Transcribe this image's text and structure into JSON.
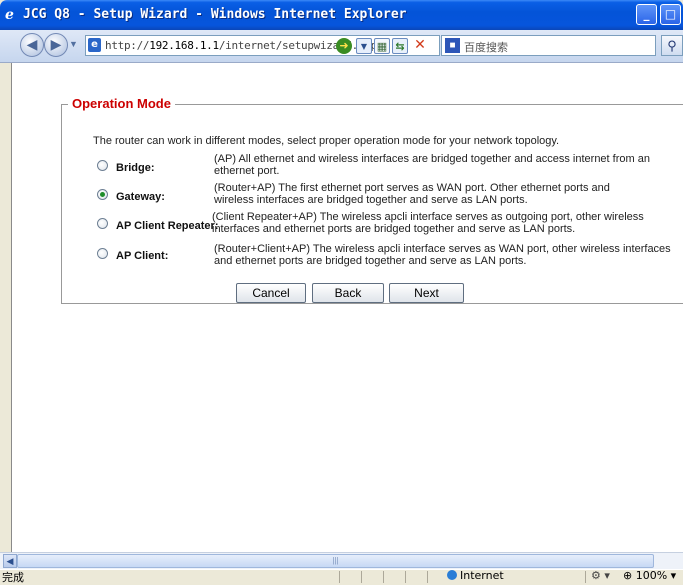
{
  "window": {
    "title": "JCG Q8 - Setup Wizard - Windows Internet Explorer",
    "icon": "ie-logo-icon"
  },
  "addressbar": {
    "url_prefix": "http://",
    "url_host": "192.168.1.1",
    "url_path": "/internet/setupwizard.asp",
    "search_placeholder": "百度搜索"
  },
  "page": {
    "legend": "Operation Mode",
    "intro": "The router can work in different modes, select proper operation mode for your network topology.",
    "options": [
      {
        "label": "Bridge:",
        "desc": "(AP) All ethernet and wireless interfaces are bridged together and access internet from an ethernet port.",
        "checked": false
      },
      {
        "label": "Gateway:",
        "desc": "(Router+AP) The first ethernet port serves as WAN port. Other ethernet ports and wireless interfaces are bridged together and serve as LAN ports.",
        "checked": true
      },
      {
        "label": "AP Client Repeater:",
        "desc": "(Client Repeater+AP) The wireless apcli interface serves as outgoing port, other wireless interfaces and ethernet ports are bridged together and serve as LAN ports.",
        "checked": false
      },
      {
        "label": "AP Client:",
        "desc": "(Router+Client+AP) The wireless apcli interface serves as WAN port, other wireless interfaces and ethernet ports are bridged together and serve as LAN ports.",
        "checked": false
      }
    ],
    "buttons": {
      "cancel": "Cancel",
      "back": "Back",
      "next": "Next"
    }
  },
  "statusbar": {
    "status": "完成",
    "zone": "Internet",
    "zoom": "100%"
  }
}
